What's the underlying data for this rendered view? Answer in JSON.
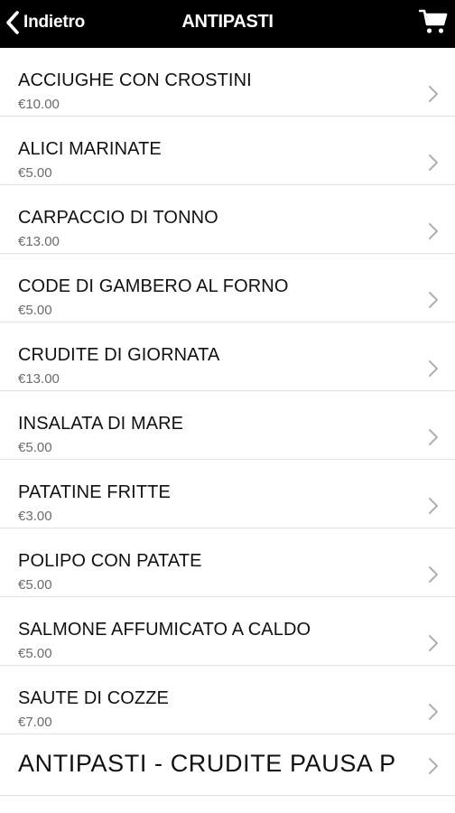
{
  "header": {
    "back_label": "Indietro",
    "title": "ANTIPASTI",
    "back_icon": "chevron-left-icon",
    "cart_icon": "shopping-cart-icon"
  },
  "menu": {
    "items": [
      {
        "name": "ACCIUGHE CON CROSTINI",
        "price": "€10.00"
      },
      {
        "name": "ALICI MARINATE",
        "price": "€5.00"
      },
      {
        "name": "CARPACCIO DI TONNO",
        "price": "€13.00"
      },
      {
        "name": "CODE DI GAMBERO AL FORNO",
        "price": "€5.00"
      },
      {
        "name": "CRUDITE DI GIORNATA",
        "price": "€13.00"
      },
      {
        "name": "INSALATA DI MARE",
        "price": "€5.00"
      },
      {
        "name": "PATATINE FRITTE",
        "price": "€3.00"
      },
      {
        "name": "POLIPO CON PATATE",
        "price": "€5.00"
      },
      {
        "name": "SALMONE AFFUMICATO A CALDO",
        "price": "€5.00"
      },
      {
        "name": "SAUTE DI COZZE",
        "price": "€7.00"
      }
    ],
    "subsection": {
      "name": "ANTIPASTI - CRUDITE PAUSA P"
    }
  },
  "colors": {
    "header_bg": "#000000",
    "header_text": "#ffffff",
    "price_text": "#6b6b6b",
    "chevron": "#b0b0b0",
    "divider": "#e0e0e0"
  }
}
